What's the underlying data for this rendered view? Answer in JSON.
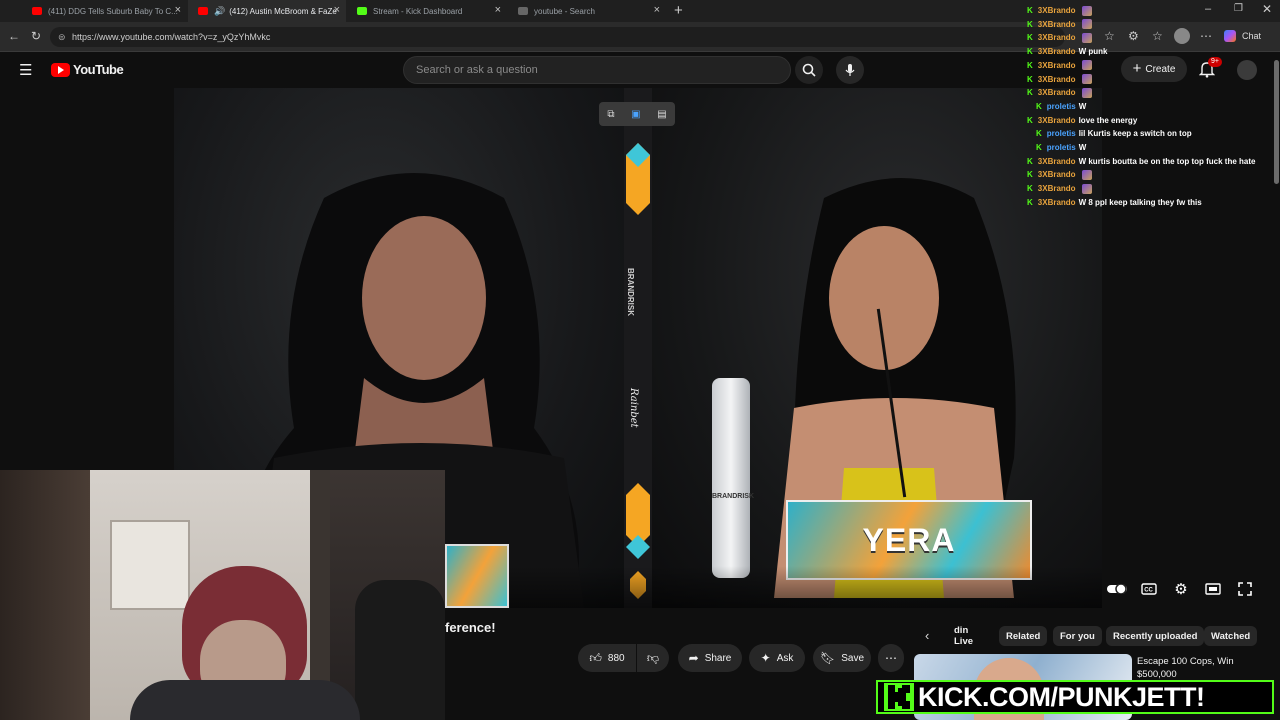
{
  "browser": {
    "tabs": [
      {
        "label": "(411) DDG Tells Suburb Baby To C...",
        "active": false,
        "favicon_color": "#ff0000"
      },
      {
        "label": "(412) Austin McBroom & FaZe",
        "active": true,
        "favicon_color": "#ff0000"
      },
      {
        "label": "Stream - Kick Dashboard",
        "active": false,
        "favicon_color": "#53fc18"
      },
      {
        "label": "youtube - Search",
        "active": false,
        "favicon_color": "#888888"
      }
    ],
    "url": "https://www.youtube.com/watch?v=z_yQzYhMvkc",
    "chat_label": "Chat"
  },
  "youtube": {
    "logo_text": "YouTube",
    "search_placeholder": "Search or ask a question",
    "create_label": "Create",
    "notifications_badge": "9+"
  },
  "video": {
    "mic_box_label": "YERA",
    "bottle_label": "BRANDRISK",
    "stripe_brand": "BRANDRISK",
    "stripe_sponsor": "Rainbet",
    "title_fragment": "ference!",
    "likes": "880",
    "actions": {
      "share": "Share",
      "ask": "Ask",
      "save": "Save"
    }
  },
  "recommendations": {
    "chips": [
      "din Live",
      "Related",
      "For you",
      "Recently uploaded",
      "Watched"
    ],
    "first_item_title": "Escape 100 Cops, Win $500,000"
  },
  "chat": {
    "messages": [
      {
        "user": "3XBrando",
        "text": "",
        "emote": true,
        "indent": false,
        "user_color": "#e8a33d"
      },
      {
        "user": "3XBrando",
        "text": "",
        "emote": true,
        "indent": false,
        "user_color": "#e8a33d"
      },
      {
        "user": "3XBrando",
        "text": "",
        "emote": true,
        "indent": false,
        "user_color": "#e8a33d"
      },
      {
        "user": "3XBrando",
        "text": "W punk",
        "emote": false,
        "indent": false,
        "user_color": "#e8a33d"
      },
      {
        "user": "3XBrando",
        "text": "",
        "emote": true,
        "indent": false,
        "user_color": "#e8a33d"
      },
      {
        "user": "3XBrando",
        "text": "",
        "emote": true,
        "indent": false,
        "user_color": "#e8a33d"
      },
      {
        "user": "3XBrando",
        "text": "",
        "emote": true,
        "indent": false,
        "user_color": "#e8a33d"
      },
      {
        "user": "proletis",
        "text": "W",
        "emote": false,
        "indent": true,
        "user_color": "#4aa3ff"
      },
      {
        "user": "3XBrando",
        "text": "love the energy",
        "emote": false,
        "indent": false,
        "user_color": "#e8a33d"
      },
      {
        "user": "proletis",
        "text": "lil Kurtis keep a switch on top",
        "emote": false,
        "indent": true,
        "user_color": "#4aa3ff"
      },
      {
        "user": "proletis",
        "text": "W",
        "emote": false,
        "indent": true,
        "user_color": "#4aa3ff"
      },
      {
        "user": "3XBrando",
        "text": "W kurtis boutta be on the top top fuck the hate",
        "emote": false,
        "indent": false,
        "user_color": "#e8a33d"
      },
      {
        "user": "3XBrando",
        "text": "",
        "emote": true,
        "indent": false,
        "user_color": "#e8a33d"
      },
      {
        "user": "3XBrando",
        "text": "",
        "emote": true,
        "indent": false,
        "user_color": "#e8a33d"
      },
      {
        "user": "3XBrando",
        "text": "W 8 ppl keep talking they fw this",
        "emote": false,
        "indent": false,
        "user_color": "#e8a33d"
      }
    ]
  },
  "overlay": {
    "kick_banner": "KICK.COM/PUNKJETT!",
    "kick_color": "#53fc18"
  }
}
